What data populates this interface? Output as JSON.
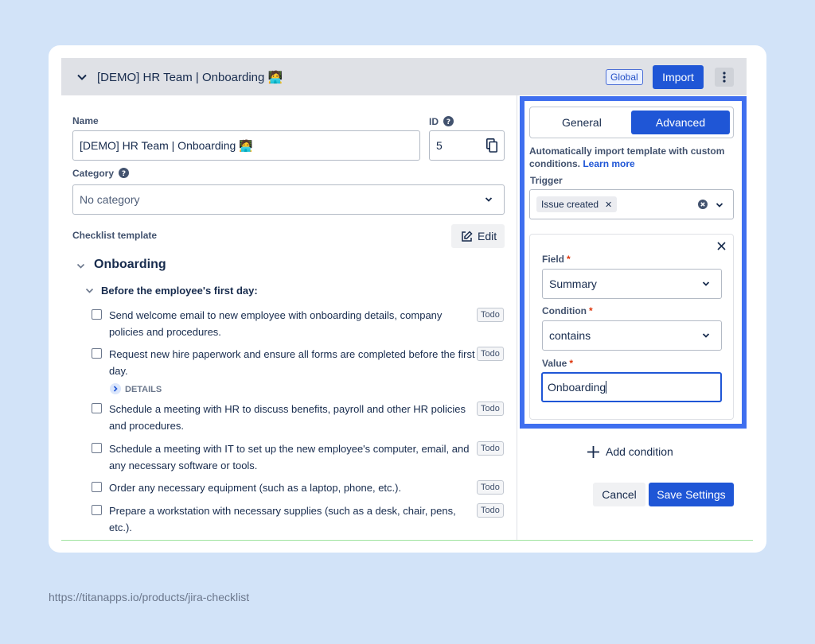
{
  "header": {
    "title": "[DEMO] HR Team | Onboarding 🧑‍💻",
    "global_badge": "Global",
    "import_label": "Import"
  },
  "form": {
    "name_label": "Name",
    "name_value": "[DEMO] HR Team | Onboarding 🧑‍💻",
    "id_label": "ID",
    "id_value": "5",
    "category_label": "Category",
    "category_value": "No category",
    "checklist_label": "Checklist template",
    "edit_label": "Edit"
  },
  "checklist": {
    "section": "Onboarding",
    "subsection": "Before the employee's first day:",
    "details_label": "DETAILS",
    "items": [
      {
        "text": "Send welcome email to new employee with onboarding details, company policies and procedures.",
        "status": "Todo"
      },
      {
        "text": "Request new hire paperwork and ensure all forms are completed before the first day.",
        "status": "Todo"
      },
      {
        "text": "Schedule a meeting with HR to discuss benefits, payroll and other HR policies and procedures.",
        "status": "Todo"
      },
      {
        "text": "Schedule a meeting with IT to set up the new employee's computer, email, and any necessary software or tools.",
        "status": "Todo"
      },
      {
        "text": "Order any necessary equipment (such as a laptop, phone, etc.).",
        "status": "Todo"
      },
      {
        "text": "Prepare a workstation with necessary supplies (such as a desk, chair, pens, etc.).",
        "status": "Todo"
      }
    ]
  },
  "settings": {
    "tab_general": "General",
    "tab_advanced": "Advanced",
    "description": "Automatically import template with custom conditions.",
    "learn_more": "Learn more",
    "trigger_label": "Trigger",
    "trigger_chip": "Issue created",
    "field_label": "Field",
    "field_value": "Summary",
    "condition_label": "Condition",
    "condition_value": "contains",
    "value_label": "Value",
    "value_value": "Onboarding",
    "add_condition": "Add condition",
    "cancel": "Cancel",
    "save": "Save Settings"
  },
  "footer": {
    "url": "https://titanapps.io/products/jira-checklist"
  },
  "colors": {
    "page_bg": "#d2e3f8",
    "primary": "#1f56d6",
    "highlight": "#3f6fef",
    "required": "#de350b"
  }
}
